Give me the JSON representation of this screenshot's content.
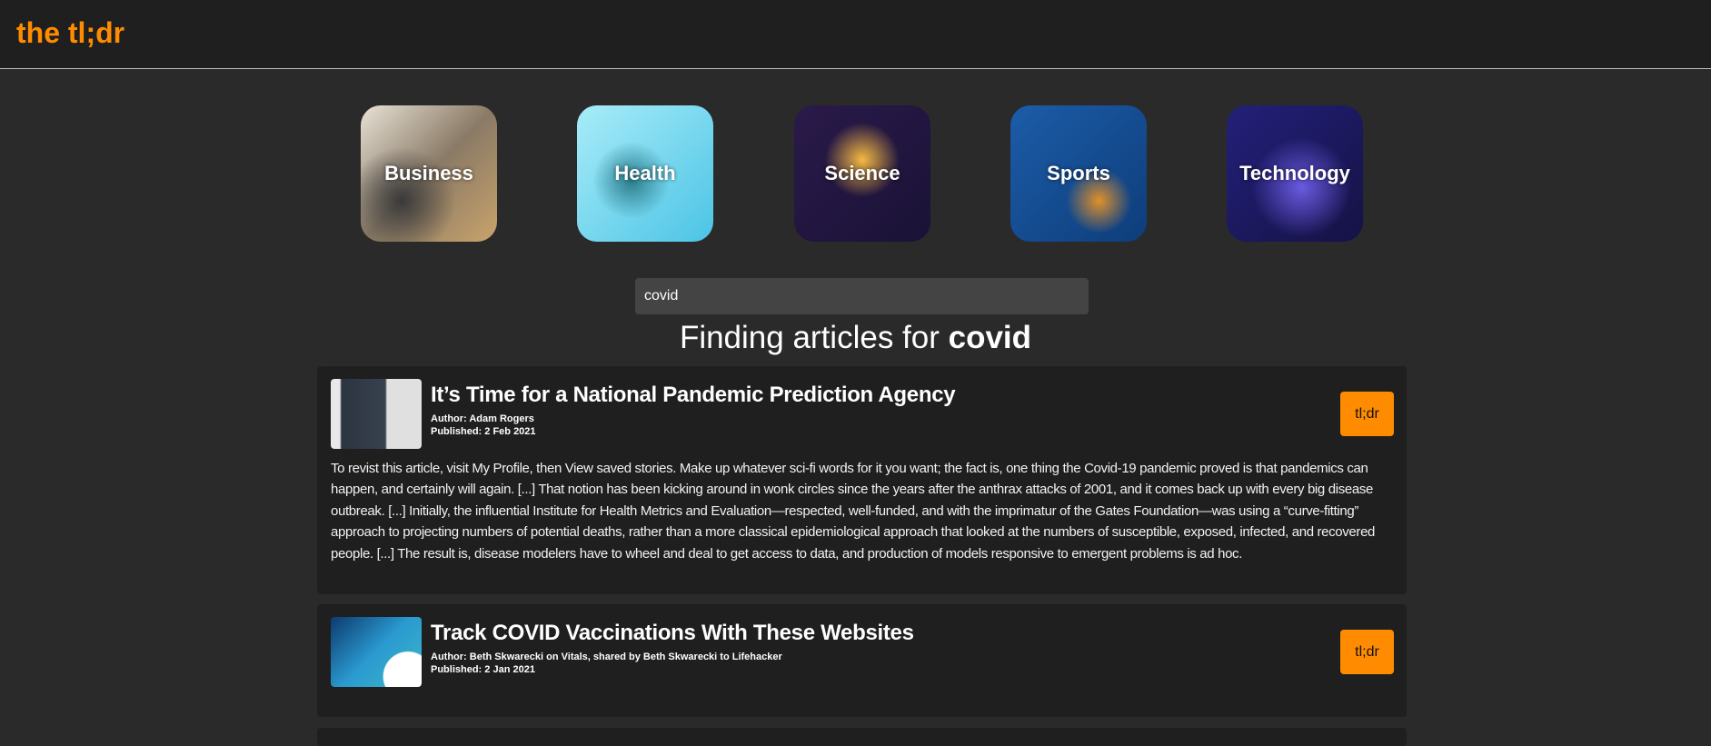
{
  "header": {
    "logo": "the tl;dr"
  },
  "categories": [
    {
      "label": "Business"
    },
    {
      "label": "Health"
    },
    {
      "label": "Science"
    },
    {
      "label": "Sports"
    },
    {
      "label": "Technology"
    }
  ],
  "search": {
    "value": "covid"
  },
  "results_heading": {
    "prefix": "Finding articles for",
    "query": "covid"
  },
  "articles": [
    {
      "title": "It’s Time for a National Pandemic Prediction Agency",
      "author": "Author: Adam Rogers",
      "published": "Published: 2 Feb 2021",
      "button": "tl;dr",
      "summary": "To revist this article, visit My Profile, then View saved stories. Make up whatever sci-fi words for it you want; the fact is, one thing the Covid-19 pandemic proved is that pandemics can happen, and certainly will again. [...] That notion has been kicking around in wonk circles since the years after the anthrax attacks of 2001, and it comes back up with every big disease outbreak. [...] Initially, the influential Institute for Health Metrics and Evaluation—respected, well-funded, and with the imprimatur of the Gates Foundation—was using a “curve-fitting” approach to projecting numbers of potential deaths, rather than a more classical epidemiological approach that looked at the numbers of susceptible, exposed, infected, and recovered people. [...] The result is, disease modelers have to wheel and deal to get access to data, and production of models responsive to emergent problems is ad hoc."
    },
    {
      "title": "Track COVID Vaccinations With These Websites",
      "author": "Author: Beth Skwarecki on Vitals, shared by Beth Skwarecki to Lifehacker",
      "published": "Published: 2 Jan 2021",
      "button": "tl;dr"
    }
  ]
}
